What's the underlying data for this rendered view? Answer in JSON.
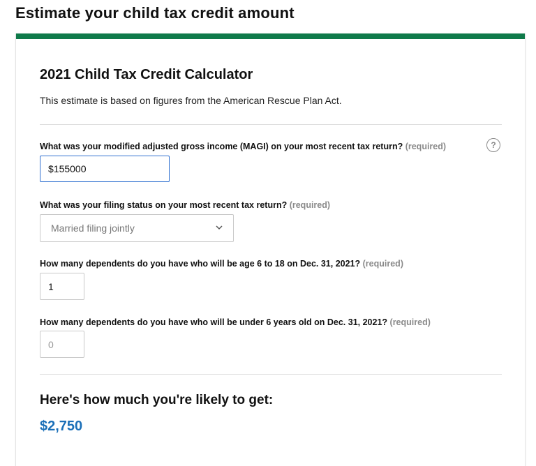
{
  "page": {
    "title": "Estimate your child tax credit amount"
  },
  "calculator": {
    "title": "2021 Child Tax Credit Calculator",
    "subtitle": "This estimate is based on figures from the American Rescue Plan Act.",
    "required_tag": "(required)",
    "help_icon_glyph": "?",
    "questions": [
      {
        "label": "What was your modified adjusted gross income (MAGI) on your most recent tax return?",
        "value": "$155000",
        "field_type": "text"
      },
      {
        "label": "What was your filing status on your most recent tax return?",
        "value": "Married filing jointly",
        "field_type": "select"
      },
      {
        "label": "How many dependents do you have who will be age 6 to 18 on Dec. 31, 2021?",
        "value": "1",
        "field_type": "number"
      },
      {
        "label": "How many dependents do you have who will be under 6 years old on Dec. 31, 2021?",
        "placeholder": "0",
        "field_type": "number"
      }
    ]
  },
  "result": {
    "heading": "Here's how much you're likely to get:",
    "amount": "$2,750"
  },
  "colors": {
    "accent_bar": "#0f7a4a",
    "result_amount": "#1a6fb8",
    "focused_input_border": "#2f6fd0",
    "required_tag": "#8a8a8a"
  },
  "icons": {
    "help": "help-icon",
    "dropdown": "chevron-down-icon"
  }
}
